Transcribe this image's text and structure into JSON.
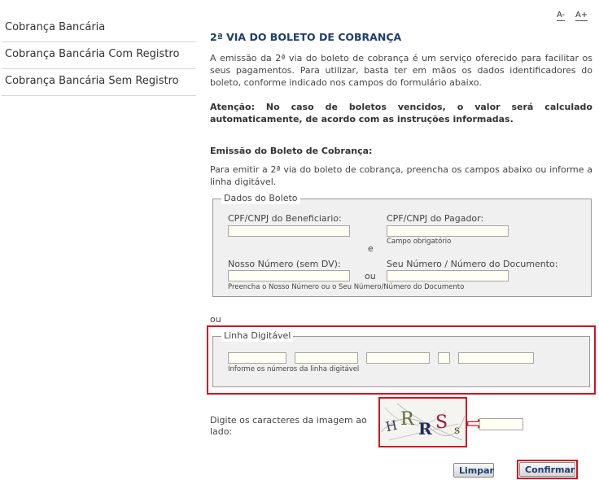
{
  "sidebar": {
    "items": [
      {
        "label": "Cobrança Bancária"
      },
      {
        "label": "Cobrança Bancária Com Registro"
      },
      {
        "label": "Cobrança Bancária Sem Registro"
      }
    ]
  },
  "font_controls": {
    "decrease": "A-",
    "increase": "A+"
  },
  "main": {
    "title": "2ª VIA DO BOLETO DE COBRANÇA",
    "intro": "A emissão da 2ª via do boleto de cobrança é um serviço oferecido para facilitar os seus pagamentos. Para utilizar, basta ter em mãos os dados identificadores do boleto, conforme indicado nos campos do formulário abaixo.",
    "attention": "Atenção: No caso de boletos vencidos, o valor será calculado automaticamente, de acordo com as instruções informadas.",
    "section_title": "Emissão do Boleto de Cobrança:",
    "section_text": "Para emitir a 2ª via do boleto de cobrança, preencha os campos abaixo ou informe a linha digitável."
  },
  "dados_boleto": {
    "legend": "Dados do Boleto",
    "cpf_beneficiario_label": "CPF/CNPJ do Beneficiario:",
    "cpf_pagador_label": "CPF/CNPJ do Pagador:",
    "campo_obrigatorio": "Campo obrigatório",
    "e_label": "e",
    "nosso_numero_label": "Nosso Número (sem DV):",
    "ou_label": "ou",
    "seu_numero_label": "Seu Número / Número do Documento:",
    "hint": "Preencha o Nosso Número ou o Seu Número/Número do Documento"
  },
  "ou_separator": "ou",
  "linha_digitavel": {
    "legend": "Linha Digitável",
    "hint": "Informe os números da linha digitável"
  },
  "captcha": {
    "label": "Digite os caracteres da imagem ao lado:",
    "chars": [
      "H",
      "R",
      "R",
      "S",
      "s"
    ],
    "arrow": "⇨"
  },
  "buttons": {
    "limpar": "Limpar",
    "confirmar": "Confirmar"
  },
  "colors": {
    "highlight_red": "#d5121e",
    "title_blue": "#1f3d70",
    "fieldset_bg": "#f0f0f0"
  }
}
